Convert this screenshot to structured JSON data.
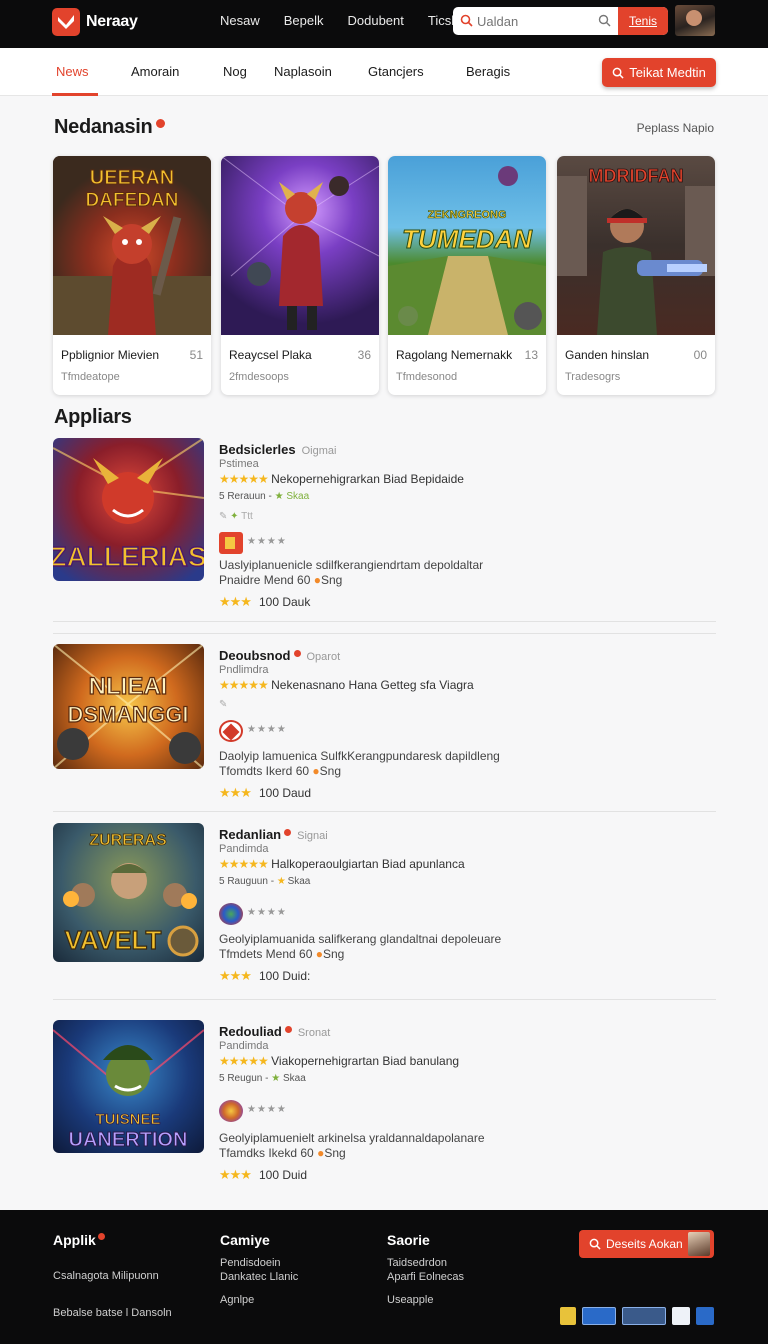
{
  "app": {
    "name": "Neraay"
  },
  "topnav": {
    "items": [
      "Nesaw",
      "Bepelk",
      "Dodubent",
      "Ticsk"
    ]
  },
  "search": {
    "placeholder": "Ualdan",
    "button": "Tenis"
  },
  "subnav": {
    "items": [
      "News",
      "Amorain",
      "Nog",
      "Naplasoin",
      "Gtancjers",
      "Beragis"
    ],
    "active": "News",
    "cta": "Teikat Medtin"
  },
  "featured": {
    "title": "Nedanasin",
    "see_all": "Peplass Napio",
    "cards": [
      {
        "title": "Ppblignior Mievien",
        "num": "51",
        "sub": "Tfmdeatope",
        "art_text": "UEERAN DAFEDAN"
      },
      {
        "title": "Reaycsel Plaka",
        "num": "36",
        "sub": "2fmdesoops",
        "art_text": ""
      },
      {
        "title": "Ragolang Nemernakk",
        "num": "13",
        "sub": "Tfmdesonod",
        "art_text": "ZEKNGREONG TUMEDAN"
      },
      {
        "title": "Ganden hinslan",
        "num": "00",
        "sub": "Tradesogrs",
        "art_text": "MDRIDFAN"
      }
    ]
  },
  "apps": {
    "title": "Appliars",
    "items": [
      {
        "name": "Bedsiclerles",
        "tag": "Oigmai",
        "dot": false,
        "sub": "Pstimea",
        "line1": "Nekopernehigrarkan Biad Bepidaide",
        "line2a": "5 Rerauun -",
        "line2b": "Skaa",
        "line3": "Ttt",
        "desc1": "Uaslyiplanuenicle sdilfkerangiendrtam depoldaltar",
        "desc2a": "Pnaidre Mend 60",
        "desc2b": "Sng",
        "rating": "100 Dauk",
        "art_text": "ZALLERIAS"
      },
      {
        "name": "Deoubsnod",
        "tag": "Oparot",
        "dot": true,
        "sub": "Pndlimdra",
        "line1": "Nekenasnano Hana Getteg sfa Viagra",
        "line2a": "",
        "line2b": "",
        "line3": "",
        "desc1": "Daolyip lamuenica SulfkKerangpundaresk dapildleng",
        "desc2a": "Tfomdts Ikerd 60",
        "desc2b": "Sng",
        "rating": "100 Daud",
        "art_text": "NLIEAI DSMANGGI"
      },
      {
        "name": "Redanlian",
        "tag": "Signai",
        "dot": true,
        "sub": "Pandimda",
        "line1": "Halkoperaoulgiartan Biad apunlanca",
        "line2a": "5 Rauguun -",
        "line2b": "Skaa",
        "line3": "",
        "desc1": "Geolyiplamuanida salifkerang glandaltnai depoleuare",
        "desc2a": "Tfmdets Mend 60",
        "desc2b": "Sng",
        "rating": "100 Duid:",
        "art_text": "VAVELT"
      },
      {
        "name": "Redouliad",
        "tag": "Sronat",
        "dot": true,
        "sub": "Pandimda",
        "line1": "Viakopernehigrartan Biad banulang",
        "line2a": "5 Reugun -",
        "line2b": "Skaa",
        "line3": "",
        "desc1": "Geolyiplamuenielt arkinelsa yraldannaldapolanare",
        "desc2a": "Tfamdks Ikekd 60",
        "desc2b": "Sng",
        "rating": "100 Duid",
        "art_text": "TUISNEE UANERTION"
      }
    ]
  },
  "footer": {
    "col1": {
      "title": "Applik",
      "line1": "Csalnagota Milipuonn",
      "line2": "Bebalse batse l Dansoln"
    },
    "col2": {
      "title": "Camiye",
      "line1": "Pendisdoein",
      "line2": "Dankatec Llanic",
      "line3": "Agnlpe"
    },
    "col3": {
      "title": "Saorie",
      "line1": "Taidsedrdon",
      "line2": "Aparfi Eolnecas",
      "line3": "Useapple"
    },
    "button": "Deseits Aokan"
  }
}
